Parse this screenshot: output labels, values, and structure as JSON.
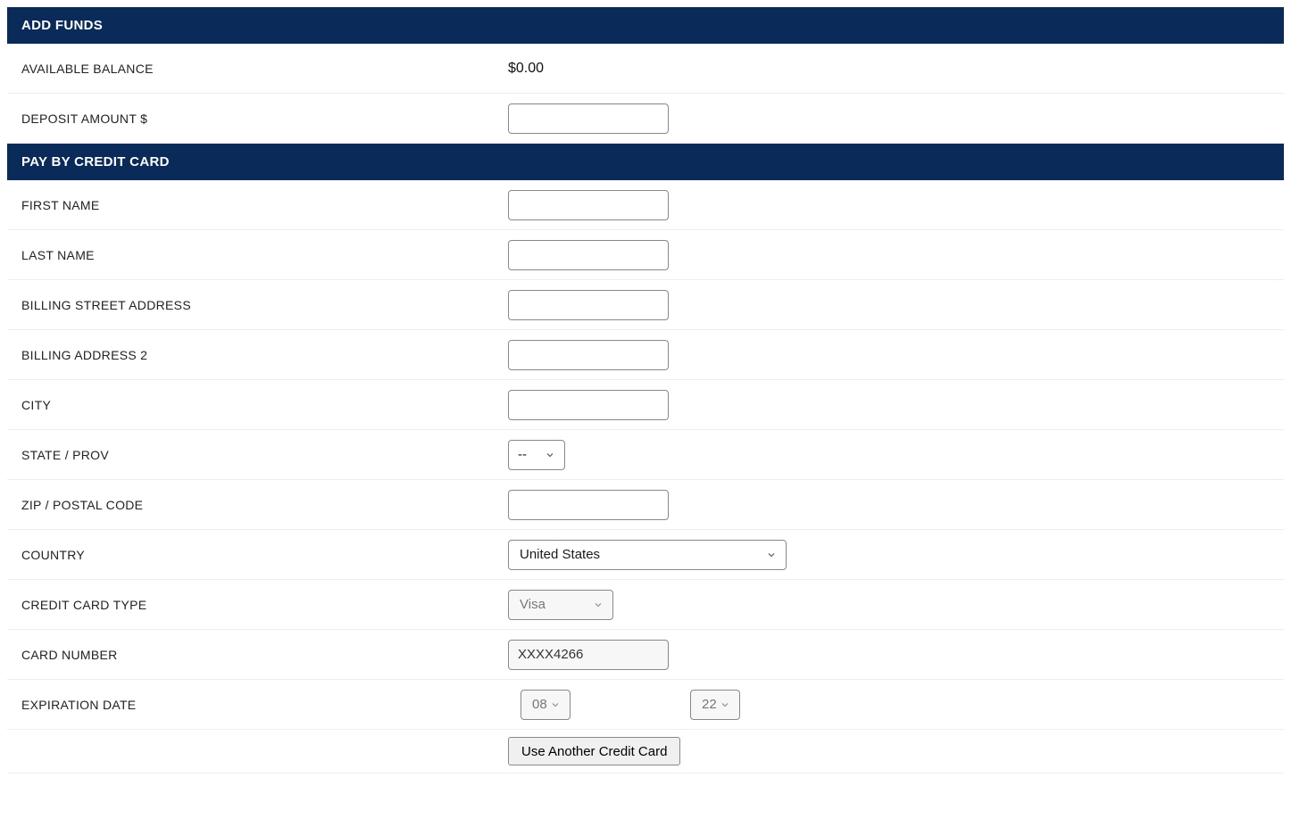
{
  "sections": {
    "add_funds": {
      "title": "ADD FUNDS",
      "available_balance_label": "AVAILABLE BALANCE",
      "available_balance_value": "$0.00",
      "deposit_amount_label": "DEPOSIT AMOUNT $",
      "deposit_amount_value": ""
    },
    "pay_by_credit_card": {
      "title": "PAY BY CREDIT CARD",
      "first_name_label": "FIRST NAME",
      "first_name_value": "",
      "last_name_label": "LAST NAME",
      "last_name_value": "",
      "billing_street_label": "BILLING STREET ADDRESS",
      "billing_street_value": "",
      "billing_address2_label": "BILLING ADDRESS 2",
      "billing_address2_value": "",
      "city_label": "CITY",
      "city_value": "",
      "state_label": "STATE / PROV",
      "state_value": "--",
      "zip_label": "ZIP / POSTAL CODE",
      "zip_value": "",
      "country_label": "COUNTRY",
      "country_value": "United States",
      "card_type_label": "CREDIT CARD TYPE",
      "card_type_value": "Visa",
      "card_number_label": "CARD NUMBER",
      "card_number_value": "XXXX4266",
      "expiration_label": "EXPIRATION DATE",
      "expiration_month": "08",
      "expiration_year": "22",
      "use_another_card_label": "Use Another Credit Card"
    }
  }
}
